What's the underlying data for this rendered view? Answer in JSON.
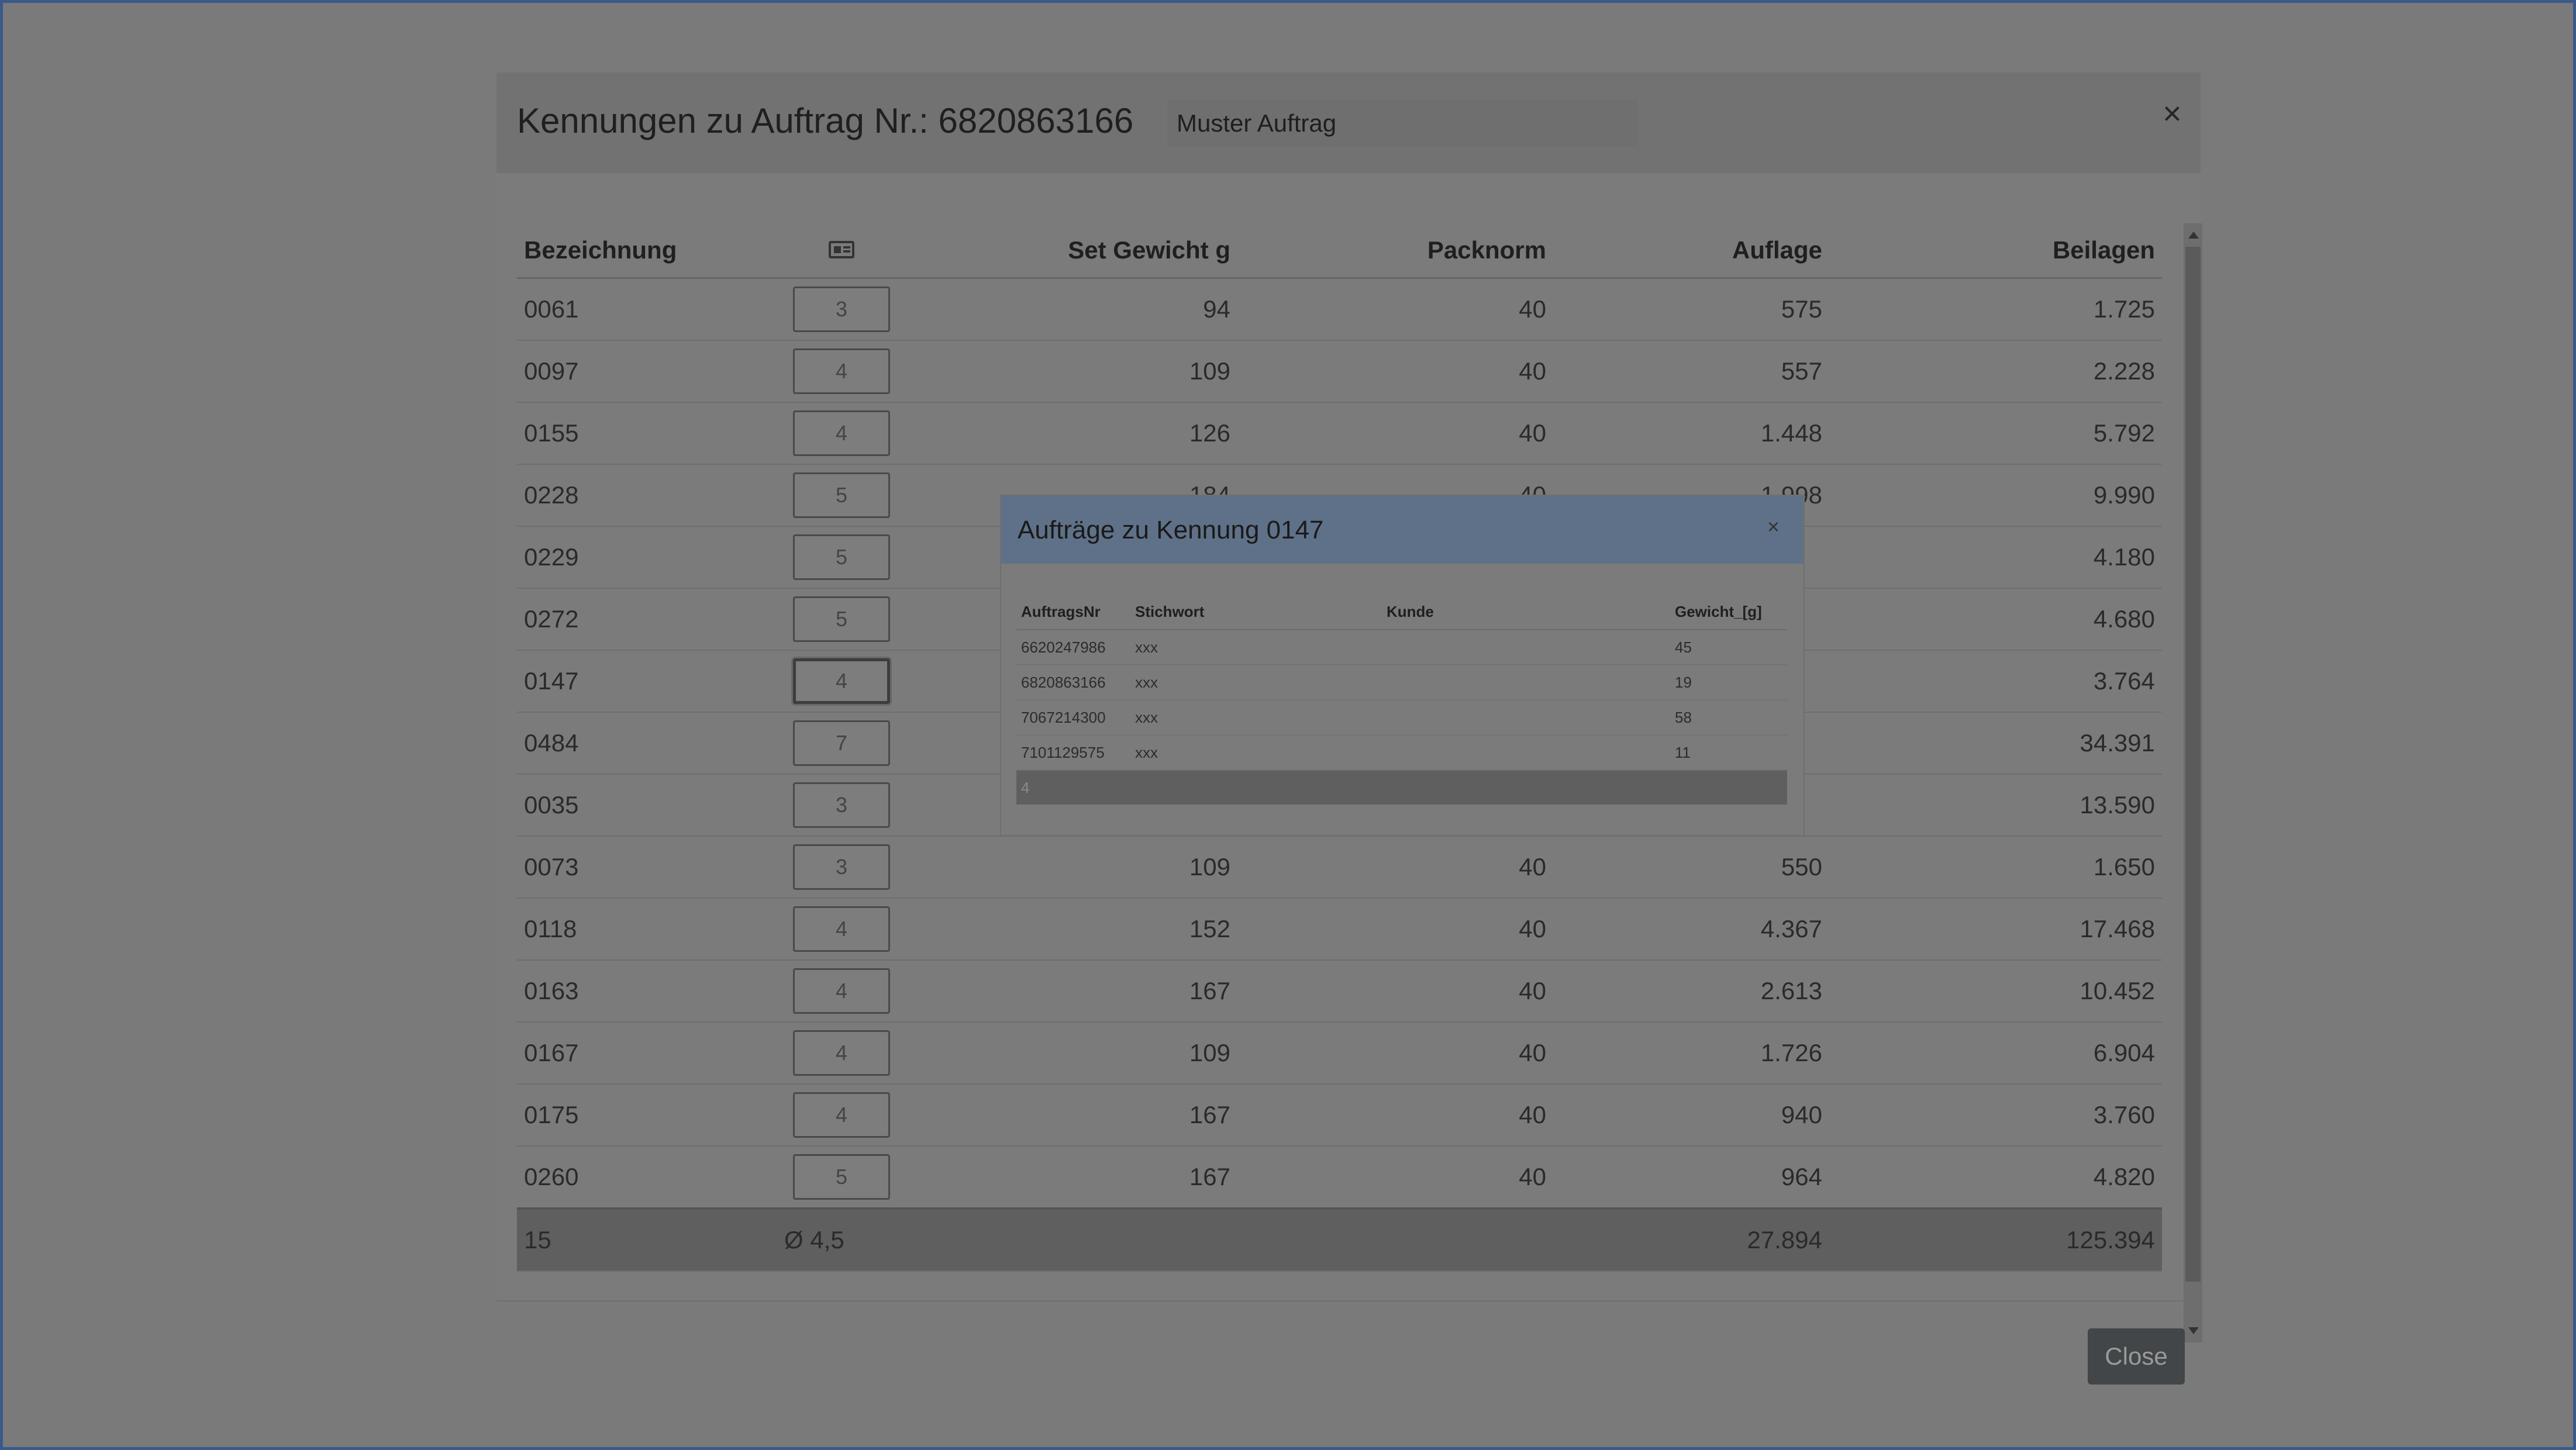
{
  "modal": {
    "title": "Kennungen zu Auftrag Nr.: 6820863166",
    "name_value": "Muster Auftrag",
    "close_symbol": "×",
    "close_button_label": "Close"
  },
  "table": {
    "headers": {
      "bezeichnung": "Bezeichnung",
      "icon": "id-card-icon",
      "set_gewicht": "Set Gewicht g",
      "packnorm": "Packnorm",
      "auflage": "Auflage",
      "beilagen": "Beilagen"
    },
    "rows": [
      {
        "bez": "0061",
        "qty": "3",
        "gew": "94",
        "pack": "40",
        "aufl": "575",
        "beil": "1.725"
      },
      {
        "bez": "0097",
        "qty": "4",
        "gew": "109",
        "pack": "40",
        "aufl": "557",
        "beil": "2.228"
      },
      {
        "bez": "0155",
        "qty": "4",
        "gew": "126",
        "pack": "40",
        "aufl": "1.448",
        "beil": "5.792"
      },
      {
        "bez": "0228",
        "qty": "5",
        "gew": "184",
        "pack": "40",
        "aufl": "1.998",
        "beil": "9.990"
      },
      {
        "bez": "0229",
        "qty": "5",
        "gew": "",
        "pack": "",
        "aufl": "",
        "beil": "4.180"
      },
      {
        "bez": "0272",
        "qty": "5",
        "gew": "",
        "pack": "",
        "aufl": "",
        "beil": "4.680"
      },
      {
        "bez": "0147",
        "qty": "4",
        "gew": "",
        "pack": "",
        "aufl": "",
        "beil": "3.764"
      },
      {
        "bez": "0484",
        "qty": "7",
        "gew": "",
        "pack": "",
        "aufl": "",
        "beil": "34.391"
      },
      {
        "bez": "0035",
        "qty": "3",
        "gew": "",
        "pack": "",
        "aufl": "",
        "beil": "13.590"
      },
      {
        "bez": "0073",
        "qty": "3",
        "gew": "109",
        "pack": "40",
        "aufl": "550",
        "beil": "1.650"
      },
      {
        "bez": "0118",
        "qty": "4",
        "gew": "152",
        "pack": "40",
        "aufl": "4.367",
        "beil": "17.468"
      },
      {
        "bez": "0163",
        "qty": "4",
        "gew": "167",
        "pack": "40",
        "aufl": "2.613",
        "beil": "10.452"
      },
      {
        "bez": "0167",
        "qty": "4",
        "gew": "109",
        "pack": "40",
        "aufl": "1.726",
        "beil": "6.904"
      },
      {
        "bez": "0175",
        "qty": "4",
        "gew": "167",
        "pack": "40",
        "aufl": "940",
        "beil": "3.760"
      },
      {
        "bez": "0260",
        "qty": "5",
        "gew": "167",
        "pack": "40",
        "aufl": "964",
        "beil": "4.820"
      }
    ],
    "footer": {
      "count": "15",
      "avg": "Ø 4,5",
      "auflage_total": "27.894",
      "beilagen_total": "125.394"
    }
  },
  "popup": {
    "title": "Aufträge zu Kennung 0147",
    "close_symbol": "×",
    "headers": [
      "AuftragsNr",
      "Stichwort",
      "Kunde",
      "Gewicht_[g]"
    ],
    "rows": [
      {
        "nr": "6620247986",
        "stichwort": "xxx",
        "kunde": "",
        "gewicht": "45"
      },
      {
        "nr": "6820863166",
        "stichwort": "xxx",
        "kunde": "",
        "gewicht": "19"
      },
      {
        "nr": "7067214300",
        "stichwort": "xxx",
        "kunde": "",
        "gewicht": "58"
      },
      {
        "nr": "7101129575",
        "stichwort": "xxx",
        "kunde": "",
        "gewicht": "11"
      }
    ],
    "footer_count": "4"
  },
  "colors": {
    "overlay": "#7a7a7a",
    "popup_header": "#5f7188",
    "window_border": "#3a5a8c",
    "close_button": "#424648"
  }
}
